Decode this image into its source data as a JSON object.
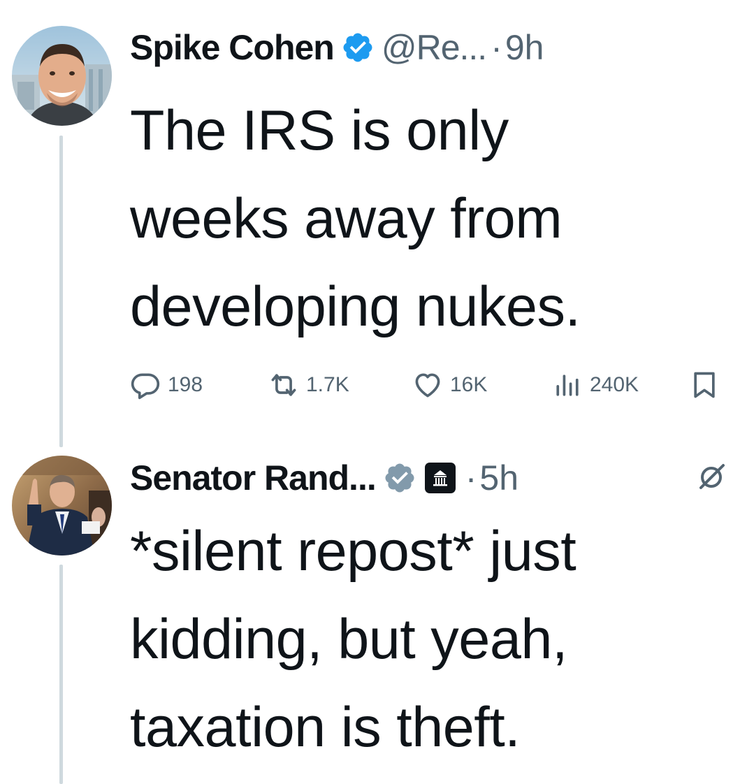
{
  "colors": {
    "text_primary": "#0f1419",
    "text_secondary": "#536471",
    "verified_blue": "#1d9bf0",
    "verified_gray": "#829aab",
    "thread_line": "#cfd9de"
  },
  "tweets": [
    {
      "display_name": "Spike Cohen",
      "verified_icon": "verified-badge-blue-icon",
      "handle": "@Re...",
      "separator": "·",
      "time": "9h",
      "text_lines": [
        "The IRS is only",
        "weeks away from",
        "developing nukes."
      ],
      "actions": {
        "replies": "198",
        "reposts": "1.7K",
        "likes": "16K",
        "views": "240K",
        "reply_icon": "reply-icon",
        "repost_icon": "repost-icon",
        "like_icon": "heart-icon",
        "views_icon": "views-icon",
        "bookmark_icon": "bookmark-icon"
      }
    },
    {
      "display_name": "Senator Rand...",
      "verified_icon": "verified-badge-gray-icon",
      "affiliation_icon": "government-building-icon",
      "separator": "·",
      "time": "5h",
      "grok_icon": "grok-icon",
      "text_lines": [
        "*silent repost* just",
        "kidding, but yeah,",
        "taxation is theft."
      ]
    }
  ]
}
